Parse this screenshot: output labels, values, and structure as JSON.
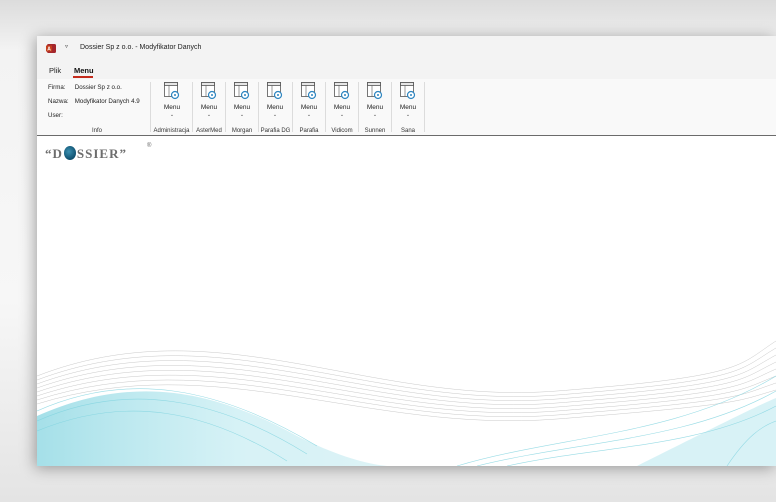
{
  "window": {
    "title": "Dossier Sp z o.o. - Modyfikator Danych"
  },
  "tabs": [
    {
      "label": "Plik"
    },
    {
      "label": "Menu"
    }
  ],
  "info": {
    "firma_label": "Firma:",
    "firma_value": "Dossier Sp z o.o.",
    "nazwa_label": "Nazwa:",
    "nazwa_value": "Modyfikator Danych 4.9",
    "user_label": "User:",
    "user_value": "",
    "group_label": "Info"
  },
  "ribbon_groups": [
    {
      "button_label": "Menu",
      "group_label": "Administracja"
    },
    {
      "button_label": "Menu",
      "group_label": "AsterMed"
    },
    {
      "button_label": "Menu",
      "group_label": "Morgan"
    },
    {
      "button_label": "Menu",
      "group_label": "Parafia DG"
    },
    {
      "button_label": "Menu",
      "group_label": "Parafia"
    },
    {
      "button_label": "Menu",
      "group_label": "Vidicom"
    },
    {
      "button_label": "Menu",
      "group_label": "Sunnen"
    },
    {
      "button_label": "Menu",
      "group_label": "Sana"
    }
  ],
  "logo": {
    "text_left": "“D",
    "text_right": "SSIER”",
    "registered": "®"
  },
  "icons": {
    "app": "access-app-icon",
    "qat": "quick-access-dropdown-icon",
    "ribbon_button": "form-gear-icon"
  },
  "colors": {
    "accent": "#c42b1c",
    "wave_cyan": "#5bc6d6"
  }
}
